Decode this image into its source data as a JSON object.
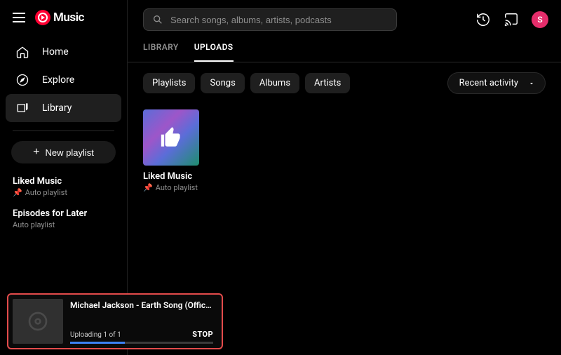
{
  "logo_text": "Music",
  "nav": {
    "home": {
      "label": "Home"
    },
    "explore": {
      "label": "Explore"
    },
    "library": {
      "label": "Library"
    }
  },
  "new_playlist_label": "New playlist",
  "side_lists": [
    {
      "title": "Liked Music",
      "sub": "Auto playlist",
      "pinned": true
    },
    {
      "title": "Episodes for Later",
      "sub": "Auto playlist",
      "pinned": false
    }
  ],
  "search_placeholder": "Search songs, albums, artists, podcasts",
  "avatar_initial": "S",
  "tabs": [
    {
      "label": "LIBRARY",
      "active": false
    },
    {
      "label": "UPLOADS",
      "active": true
    }
  ],
  "chips": [
    "Playlists",
    "Songs",
    "Albums",
    "Artists"
  ],
  "sort_label": "Recent activity",
  "card": {
    "title": "Liked Music",
    "sub": "Auto playlist"
  },
  "upload": {
    "title": "Michael Jackson - Earth Song (Offici…",
    "status": "Uploading 1 of 1",
    "stop": "STOP"
  }
}
